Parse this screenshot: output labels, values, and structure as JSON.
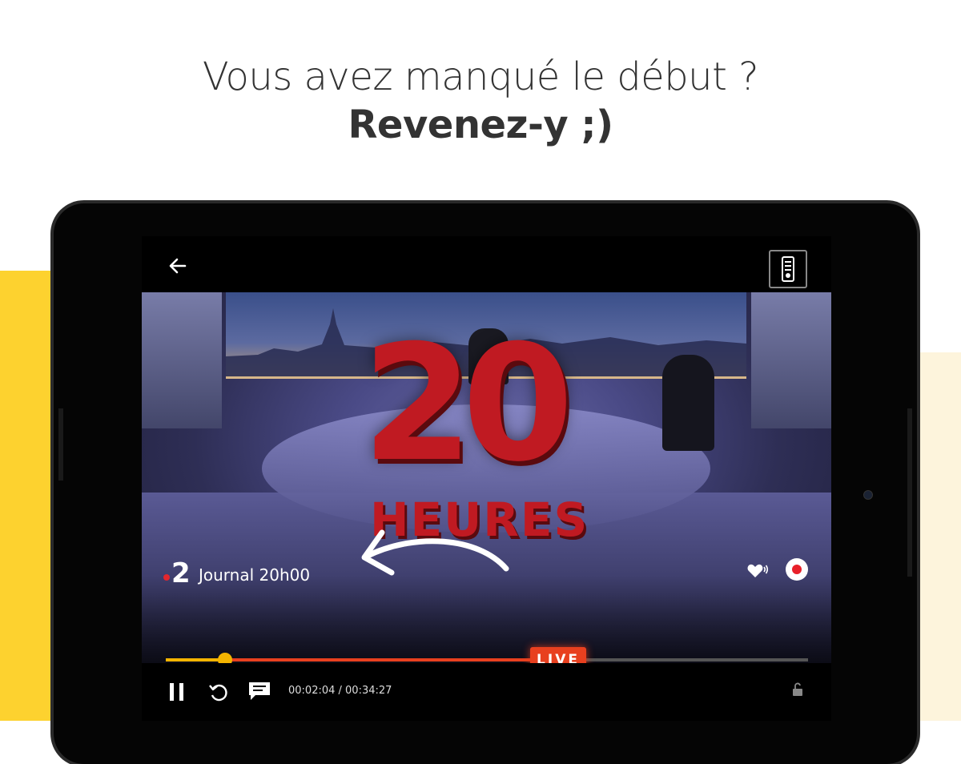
{
  "headline": {
    "line1": "Vous avez manqué le début ?",
    "line2": "Revenez-y ;)"
  },
  "player": {
    "back_icon": "arrow-left-icon",
    "remote_icon": "remote-control-icon",
    "channel": {
      "logo_number": "2",
      "program": "Journal 20h00"
    },
    "video_overlay": {
      "logo_big": "20",
      "logo_small": "HEURES"
    },
    "live_label": "LIVE",
    "progress": {
      "watched_fraction": 0.092,
      "buffer_fraction": 0.58
    },
    "time_display": "00:02:04 / 00:34:27",
    "icons": [
      "heart-sound-icon",
      "record-icon",
      "pause-icon",
      "replay-icon",
      "chat-icon",
      "unlock-icon"
    ]
  },
  "colors": {
    "accent_yellow": "#fdd22f",
    "live_red": "#e8401f",
    "progress_yellow": "#f4b400"
  }
}
